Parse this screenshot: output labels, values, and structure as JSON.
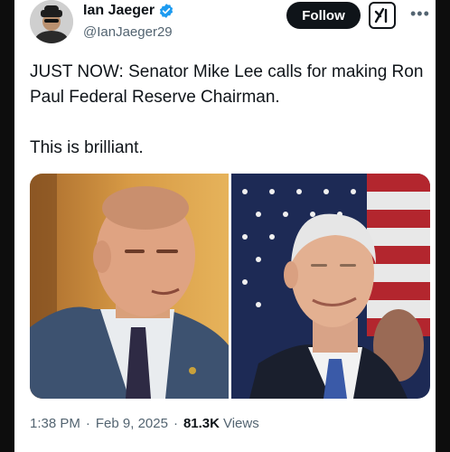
{
  "author": {
    "name": "Ian Jaeger",
    "handle": "@IanJaeger29"
  },
  "actions": {
    "follow_label": "Follow",
    "grok_icon": "grok-icon",
    "more_icon": "more-options-icon"
  },
  "tweet": {
    "line1": "JUST NOW: Senator Mike Lee calls for making Ron Paul Federal Reserve Chairman.",
    "line2": "This is brilliant."
  },
  "media": {
    "count": 2
  },
  "meta": {
    "time": "1:38 PM",
    "separator": "·",
    "date": "Feb 9, 2025",
    "views_count": "81.3K",
    "views_label": "Views"
  },
  "colors": {
    "text": "#0f1419",
    "secondary": "#536471",
    "verified": "#1d9bf0"
  }
}
